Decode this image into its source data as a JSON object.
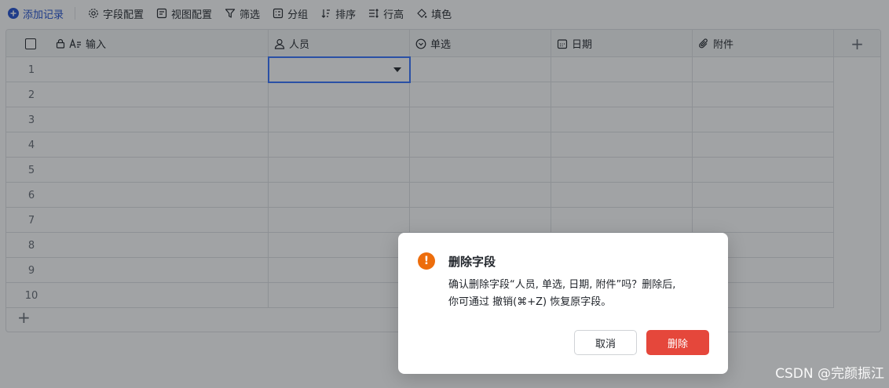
{
  "toolbar": {
    "add_record": "添加记录",
    "field_config": "字段配置",
    "view_config": "视图配置",
    "filter": "筛选",
    "group": "分组",
    "sort": "排序",
    "row_height": "行高",
    "fill_color": "填色"
  },
  "columns": [
    {
      "label": "输入",
      "icon": "text-icon",
      "locked": true
    },
    {
      "label": "人员",
      "icon": "person-icon"
    },
    {
      "label": "单选",
      "icon": "single-select-icon"
    },
    {
      "label": "日期",
      "icon": "calendar-icon"
    },
    {
      "label": "附件",
      "icon": "attachment-icon"
    }
  ],
  "rows": [
    "1",
    "2",
    "3",
    "4",
    "5",
    "6",
    "7",
    "8",
    "9",
    "10"
  ],
  "add_column_symbol": "+",
  "add_row_symbol": "+",
  "dialog": {
    "title": "删除字段",
    "message_line1": "确认删除字段“人员, 单选, 日期, 附件”吗？删除后,",
    "message_line2": "你可通过 撤销(⌘+Z) 恢复原字段。",
    "cancel": "取消",
    "confirm": "删除",
    "warning_symbol": "!"
  },
  "watermark": "CSDN @完颜振江",
  "colors": {
    "primary": "#1f4ecf",
    "active_border": "#3370ff",
    "danger": "#e5473b",
    "warning": "#ed6d0c"
  }
}
